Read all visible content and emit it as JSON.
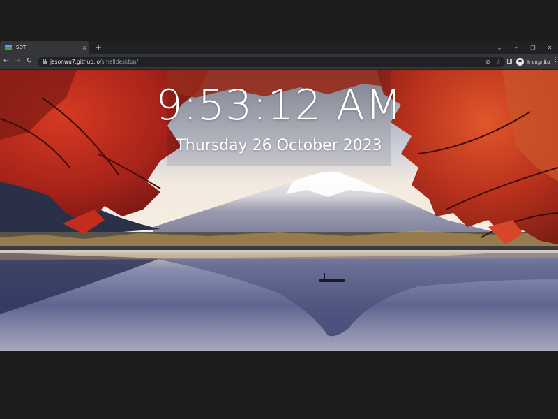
{
  "tab": {
    "title": "SDT",
    "close": "×"
  },
  "new_tab": "+",
  "window_controls": {
    "dropdown": "⌄",
    "minimize": "–",
    "restore": "❐",
    "close": "✕"
  },
  "nav": {
    "back": "←",
    "forward": "→",
    "reload": "↻"
  },
  "address": {
    "host": "jasonwu7.github.io",
    "path": "/smalldesktop/"
  },
  "omnibox_icons": {
    "tracking": "⊘",
    "bookmark": "☆"
  },
  "profile": {
    "label": "Incognito"
  },
  "menu": "⋮",
  "clock": {
    "time": "9:53:12 AM",
    "date": "Thursday 26 October 2023"
  },
  "colors": {
    "sky_top": "#d7dce6",
    "lake": "#6c7399",
    "maple_red": "#b4281c",
    "chrome_dark": "#35363a"
  }
}
